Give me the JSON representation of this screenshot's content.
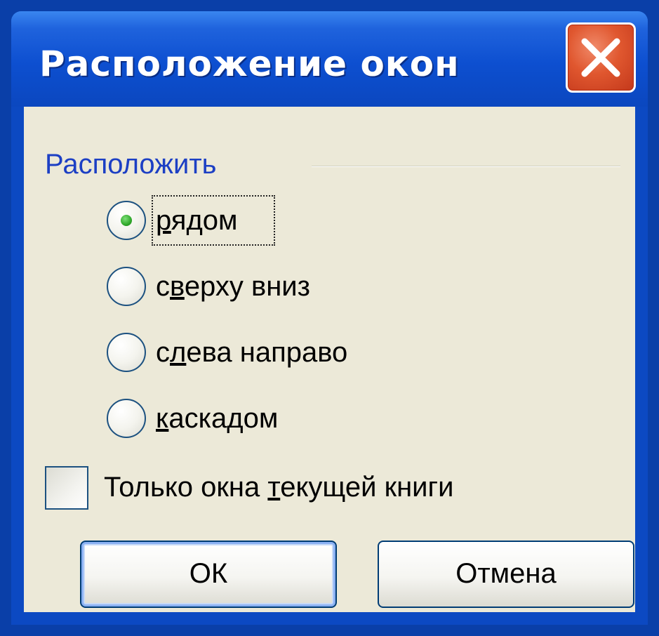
{
  "dialog": {
    "title": "Расположение окон"
  },
  "arrange_group": {
    "label": "Расположить",
    "options": [
      {
        "pre": "",
        "key": "р",
        "post": "ядом",
        "selected": true
      },
      {
        "pre": "с",
        "key": "в",
        "post": "ерху вниз",
        "selected": false
      },
      {
        "pre": "с",
        "key": "л",
        "post": "ева направо",
        "selected": false
      },
      {
        "pre": "",
        "key": "к",
        "post": "аскадом",
        "selected": false
      }
    ]
  },
  "current_book_only": {
    "pre": "Только окна ",
    "key": "т",
    "post": "екущей книги",
    "checked": false
  },
  "buttons": {
    "ok_label": "ОК",
    "cancel_label": "Отмена"
  },
  "icons": {
    "close": "close-icon"
  },
  "colors": {
    "titlebar": "#0c49c2",
    "close_button": "#e0572f",
    "dialog_face": "#ece9d8",
    "group_label": "#1c3fc4",
    "radio_selected": "#2fa82a"
  }
}
